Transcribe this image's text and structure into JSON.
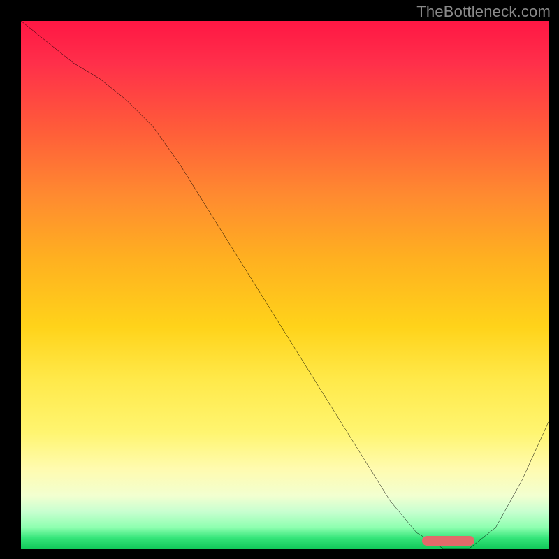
{
  "watermark": "TheBottleneck.com",
  "colors": {
    "gradient_top": "#ff1744",
    "gradient_bottom": "#12c95a",
    "curve": "#000000",
    "optimum_bar": "#e26a6a",
    "frame_bg": "#000000"
  },
  "chart_data": {
    "type": "line",
    "title": "",
    "xlabel": "",
    "ylabel": "",
    "xlim": [
      0,
      100
    ],
    "ylim": [
      0,
      100
    ],
    "x": [
      0,
      5,
      10,
      15,
      20,
      25,
      30,
      35,
      40,
      45,
      50,
      55,
      60,
      65,
      70,
      75,
      80,
      85,
      90,
      95,
      100
    ],
    "values": [
      100,
      96,
      92,
      89,
      85,
      80,
      73,
      65,
      57,
      49,
      41,
      33,
      25,
      17,
      9,
      3,
      0,
      0,
      4,
      13,
      24
    ],
    "optimum_range_x": [
      76,
      86
    ],
    "grid": false,
    "legend": null
  }
}
